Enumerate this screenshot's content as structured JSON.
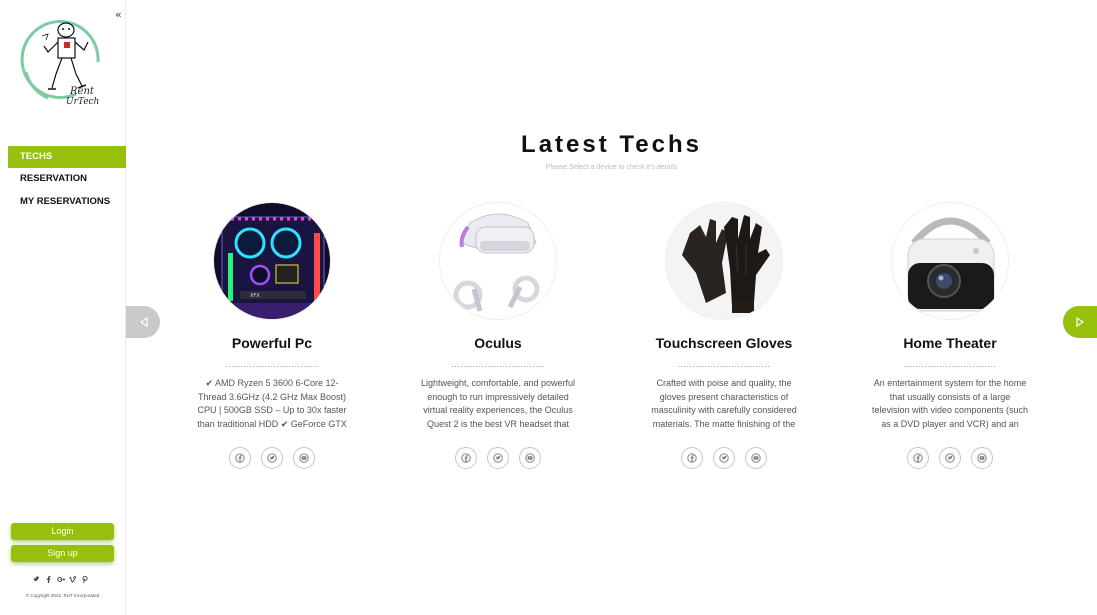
{
  "sidebar": {
    "collapse_glyph": "«",
    "logo_text_1": "Rent",
    "logo_text_2": "UrTech",
    "nav": [
      {
        "label": "TECHS"
      },
      {
        "label": "RESERVATION"
      },
      {
        "label": "MY RESERVATIONS"
      }
    ],
    "login_label": "Login",
    "signup_label": "Sign up",
    "socials": [
      "twitter-icon",
      "facebook-icon",
      "google-plus-icon",
      "vimeo-icon",
      "pinterest-icon"
    ],
    "copyright": "© Copyright 2022. RUT Incorporated"
  },
  "main": {
    "heading": "Latest Techs",
    "subheading": "Please Select a device to check it's details",
    "cards": [
      {
        "title": "Powerful Pc",
        "dots": "...............................",
        "description": "✔ AMD Ryzen 5 3600 6-Core 12-Thread 3.6GHz (4.2 GHz Max Boost) CPU | 500GB SSD – Up to 30x faster than traditional HDD ✔ GeForce GTX",
        "image": "gaming-pc-photo"
      },
      {
        "title": "Oculus",
        "dots": "...............................",
        "description": "Lightweight, comfortable, and powerful enough to run impressively detailed virtual reality experiences, the Oculus Quest 2 is the best VR headset that",
        "image": "vr-headset-photo"
      },
      {
        "title": "Touchscreen Gloves",
        "dots": "...............................",
        "description": "Crafted with poise and quality, the gloves present characteristics of masculinity with carefully considered materials. The matte finishing of the",
        "image": "leather-gloves-photo"
      },
      {
        "title": "Home Theater",
        "dots": "...............................",
        "description": "An entertainment system for the home that usually consists of a large television with video components (such as a DVD player and VCR) and an audio",
        "image": "mini-projector-photo"
      }
    ],
    "card_icons": [
      "facebook-icon",
      "twitter-icon",
      "youtube-icon"
    ]
  },
  "colors": {
    "accent": "#97bf0d",
    "arrow_disabled": "#c9c9c9",
    "logo_ring": "#7ccba1"
  }
}
